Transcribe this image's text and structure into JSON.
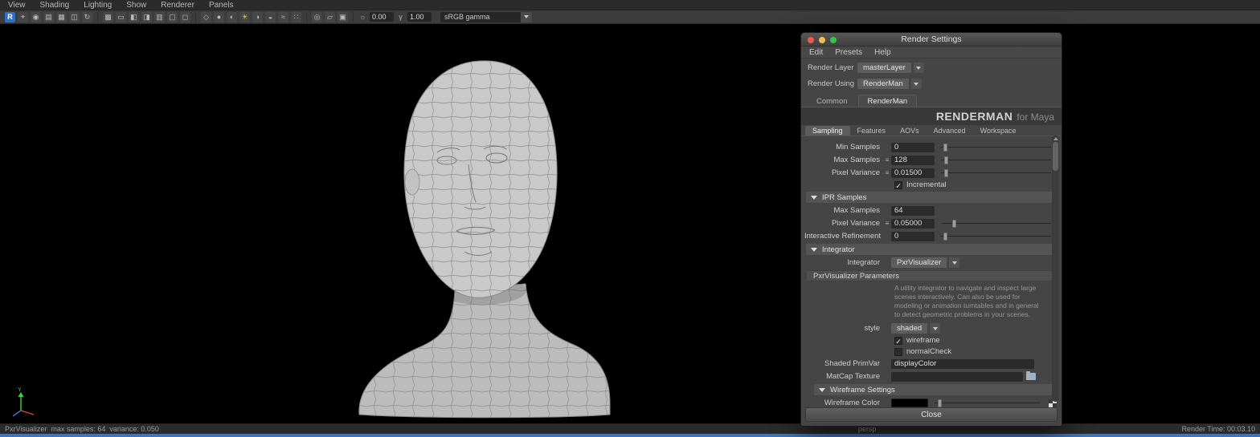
{
  "colors": {
    "accent_blue": "#3a76c4",
    "viewport_bg": "#000000",
    "mesh_fill": "#c9c9c9",
    "mesh_wire": "#8d8d8d",
    "traffic_red": "#f4574e",
    "traffic_yellow": "#f5bf4f",
    "traffic_green": "#33c748",
    "wireframe_color_swatch": "#000000"
  },
  "menubar": {
    "items": [
      "View",
      "Shading",
      "Lighting",
      "Show",
      "Renderer",
      "Panels"
    ]
  },
  "toolbar": {
    "icons": [
      {
        "name": "renderman",
        "glyph": "R"
      },
      {
        "name": "select-camera",
        "glyph": "⌖"
      },
      {
        "name": "lock-camera",
        "glyph": "◉"
      },
      {
        "name": "camera-attributes",
        "glyph": "▤"
      },
      {
        "name": "bookmark",
        "glyph": "▦"
      },
      {
        "name": "image-plane",
        "glyph": "◫"
      },
      {
        "name": "refresh",
        "glyph": "↻"
      },
      {
        "name": "grid",
        "glyph": "▩"
      },
      {
        "name": "film-gate",
        "glyph": "▭"
      },
      {
        "name": "resolution-gate",
        "glyph": "◧"
      },
      {
        "name": "gate-mask",
        "glyph": "◨"
      },
      {
        "name": "field-chart",
        "glyph": "▥"
      },
      {
        "name": "safe-action",
        "glyph": "▢"
      },
      {
        "name": "safe-title",
        "glyph": "◻"
      },
      {
        "name": "wireframe",
        "glyph": "◇"
      },
      {
        "name": "shaded",
        "glyph": "●"
      },
      {
        "name": "textured",
        "glyph": "◐"
      },
      {
        "name": "lights",
        "glyph": "☀"
      },
      {
        "name": "shadows",
        "glyph": "◑"
      },
      {
        "name": "ambient-occlusion",
        "glyph": "◒"
      },
      {
        "name": "motion-blur",
        "glyph": "≈"
      },
      {
        "name": "multisampling",
        "glyph": "∷"
      },
      {
        "name": "isolate-select",
        "glyph": "◎"
      },
      {
        "name": "xray",
        "glyph": "▱"
      },
      {
        "name": "snapshot",
        "glyph": "▣"
      }
    ],
    "exposure_icon": "☼",
    "exposure": "0.00",
    "gamma_icon": "γ",
    "gamma": "1.00",
    "view_transform": "sRGB gamma"
  },
  "viewport": {
    "axis_y": "Y"
  },
  "statusbar": {
    "left": "PxrVisualizer  max samples: 64  variance: 0.050",
    "center": "persp",
    "right": "Render Time: 00:03.10"
  },
  "dialog": {
    "title": "Render Settings",
    "menu": [
      "Edit",
      "Presets",
      "Help"
    ],
    "render_layer": {
      "label": "Render Layer",
      "value": "masterLayer"
    },
    "render_using": {
      "label": "Render Using",
      "value": "RenderMan"
    },
    "tabs": [
      "Common",
      "RenderMan"
    ],
    "active_tab": "RenderMan",
    "brand": {
      "name": "RENDERMAN",
      "suffix": "for Maya"
    },
    "subtabs": [
      "Sampling",
      "Features",
      "AOVs",
      "Advanced",
      "Workspace"
    ],
    "active_subtab": "Sampling",
    "sampling": {
      "min_samples": {
        "label": "Min Samples",
        "value": "0"
      },
      "max_samples": {
        "label": "Max Samples",
        "expr": "≡",
        "value": "128"
      },
      "pixel_variance": {
        "label": "Pixel Variance",
        "expr": "≡",
        "value": "0.01500"
      },
      "incremental": {
        "label": "Incremental",
        "check": "✓"
      },
      "ipr_header": "IPR Samples",
      "ipr_max_samples": {
        "label": "Max Samples",
        "value": "64"
      },
      "ipr_pixel_variance": {
        "label": "Pixel Variance",
        "expr": "≡",
        "value": "0.05000"
      },
      "interactive_refinement": {
        "label": "Interactive Refinement",
        "value": "0"
      },
      "integrator_header": "Integrator",
      "integrator": {
        "label": "Integrator",
        "value": "PxrVisualizer"
      },
      "params_header": "PxrVisualizer Parameters",
      "description": "A utility integrator to navigate and inspect large scenes interactively. Can also be used for modeling or animation turntables and in general to detect geometric problems in your scenes.",
      "style": {
        "label": "style",
        "value": "shaded"
      },
      "wireframe": {
        "label": "wireframe",
        "check": "✓"
      },
      "normal_check": {
        "label": "normalCheck",
        "check": ""
      },
      "shaded_primvar": {
        "label": "Shaded PrimVar",
        "value": "displayColor"
      },
      "matcap": {
        "label": "MatCap Texture",
        "value": ""
      },
      "wireframe_settings_header": "Wireframe Settings",
      "wireframe_color": {
        "label": "Wireframe Color"
      }
    },
    "close_label": "Close"
  }
}
